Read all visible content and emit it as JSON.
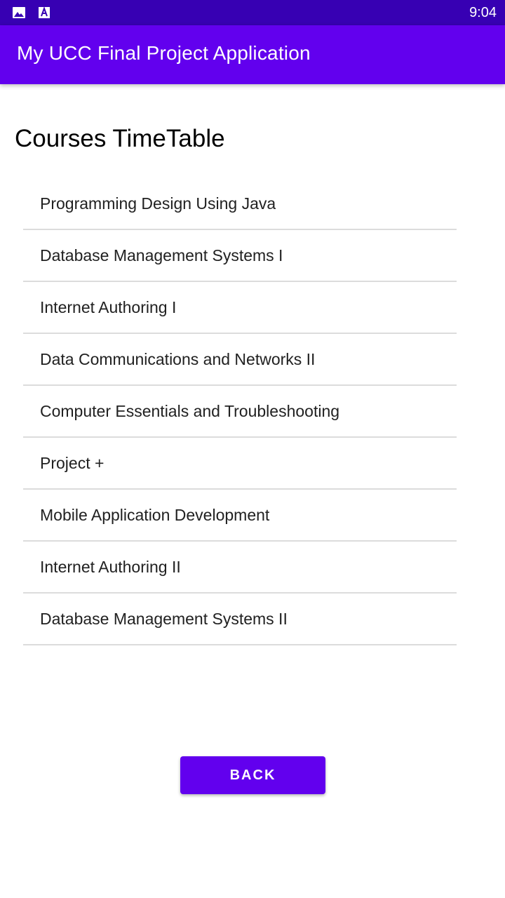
{
  "status_bar": {
    "time": "9:04",
    "icons": [
      "image-icon",
      "font-a-icon"
    ]
  },
  "app_bar": {
    "title": "My UCC Final Project Application",
    "color": "#6200ee"
  },
  "main": {
    "heading": "Courses TimeTable",
    "courses": [
      "Programming Design Using Java",
      "Database Management Systems I",
      "Internet Authoring I",
      "Data Communications and Networks II",
      "Computer Essentials and Troubleshooting",
      "Project +",
      "Mobile Application Development",
      "Internet Authoring II",
      "Database Management Systems II"
    ]
  },
  "footer": {
    "back_label": "BACK"
  },
  "colors": {
    "status_bar": "#3700b3",
    "primary": "#6200ee",
    "divider": "#dcdcdc"
  }
}
